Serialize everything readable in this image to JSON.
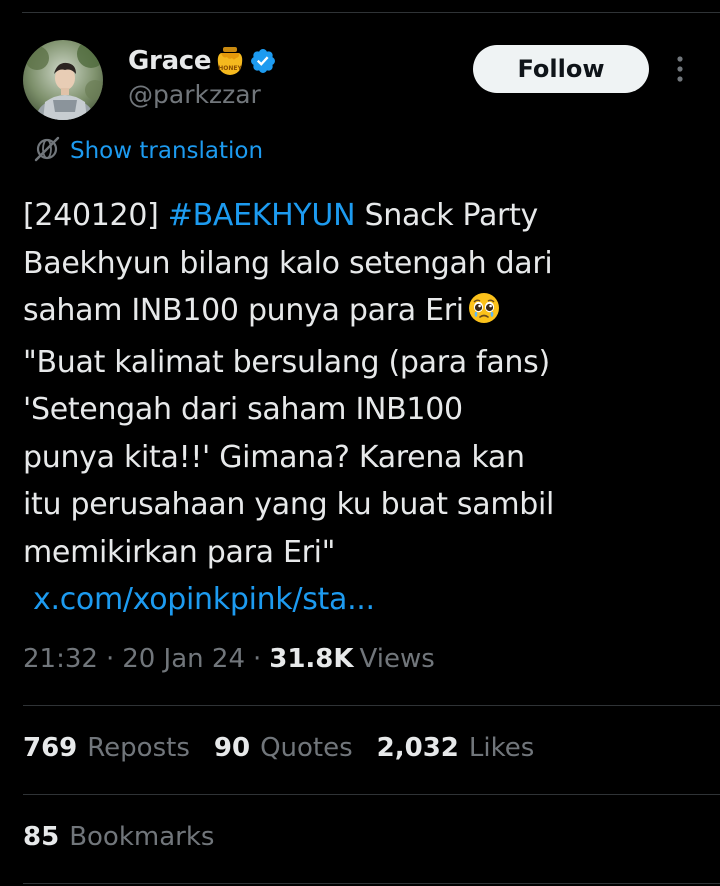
{
  "author": {
    "display_name": "Grace",
    "name_emoji_icon": "honey-pot-icon",
    "verified_icon": "verified-badge-icon",
    "handle": "@parkzzar"
  },
  "follow_button": {
    "label": "Follow"
  },
  "more_menu_icon": "vertical-dots-icon",
  "translation": {
    "icon": "globe-icon",
    "label": "Show translation"
  },
  "tweet": {
    "hashtag_prefix": "[240120]",
    "hashtag": "#BAEKHYUN",
    "line1_rest": "Snack Party",
    "line2": "Baekhyun bilang kalo setengah dari",
    "line3": "saham INB100 punya para Eri",
    "line3_emoji": "pleading-face-emoji",
    "line4": "\"Buat kalimat bersulang (para fans)",
    "line5": "'Setengah dari saham INB100",
    "line6": "punya kita!!' Gimana? Karena kan",
    "line7": "itu perusahaan yang ku buat sambil",
    "line8": "memikirkan para Eri\"",
    "link": "x.com/xopinkpink/sta..."
  },
  "meta": {
    "time": "21:32",
    "separator": "·",
    "date": "20 Jan 24",
    "views_count": "31.8K",
    "views_label": "Views"
  },
  "stats": {
    "reposts_count": "769",
    "reposts_label": "Reposts",
    "quotes_count": "90",
    "quotes_label": "Quotes",
    "likes_count": "2,032",
    "likes_label": "Likes",
    "bookmarks_count": "85",
    "bookmarks_label": "Bookmarks"
  },
  "colors": {
    "background": "#000000",
    "text": "#e7e9ea",
    "muted": "#71767b",
    "accent": "#1d9bf0",
    "divider": "#2f3336",
    "follow_bg": "#eff3f4"
  }
}
